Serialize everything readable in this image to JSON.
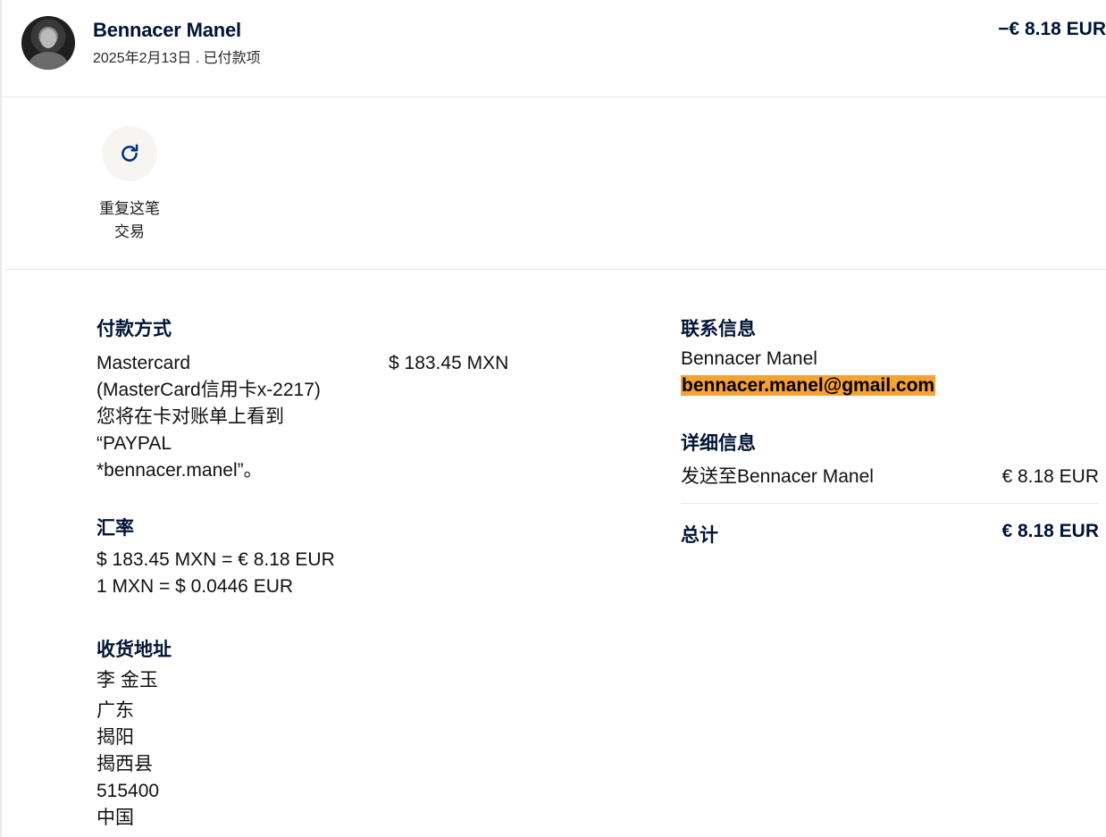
{
  "header": {
    "name": "Bennacer Manel",
    "subline": "2025年2月13日 . 已付款项",
    "amount": "−€ 8.18 EUR"
  },
  "actions": {
    "repeat_label_line1": "重复这笔",
    "repeat_label_line2": "交易",
    "repeat_icon": "refresh-icon"
  },
  "payment": {
    "title": "付款方式",
    "lines": [
      "Mastercard",
      "(MasterCard信用卡x-2217)",
      "您将在卡对账单上看到",
      "“PAYPAL",
      "*bennacer.manel”。"
    ],
    "amount": "$ 183.45 MXN"
  },
  "exchange": {
    "title": "汇率",
    "line1": "$ 183.45 MXN = € 8.18 EUR",
    "line2": "1 MXN = $ 0.0446 EUR"
  },
  "shipping": {
    "title": "收货地址",
    "lines": [
      "李 金玉",
      "广东",
      "揭阳",
      "揭西县",
      "515400",
      "中国"
    ]
  },
  "contact": {
    "title": "联系信息",
    "name": "Bennacer Manel",
    "email": "bennacer.manel@gmail.com"
  },
  "details": {
    "title": "详细信息",
    "row_label": "发送至Bennacer Manel",
    "row_value": "€ 8.18 EUR",
    "total_label": "总计",
    "total_value": "€ 8.18 EUR"
  },
  "colors": {
    "text": "#001435",
    "highlight": "#f7a033",
    "icon": "#003087"
  }
}
